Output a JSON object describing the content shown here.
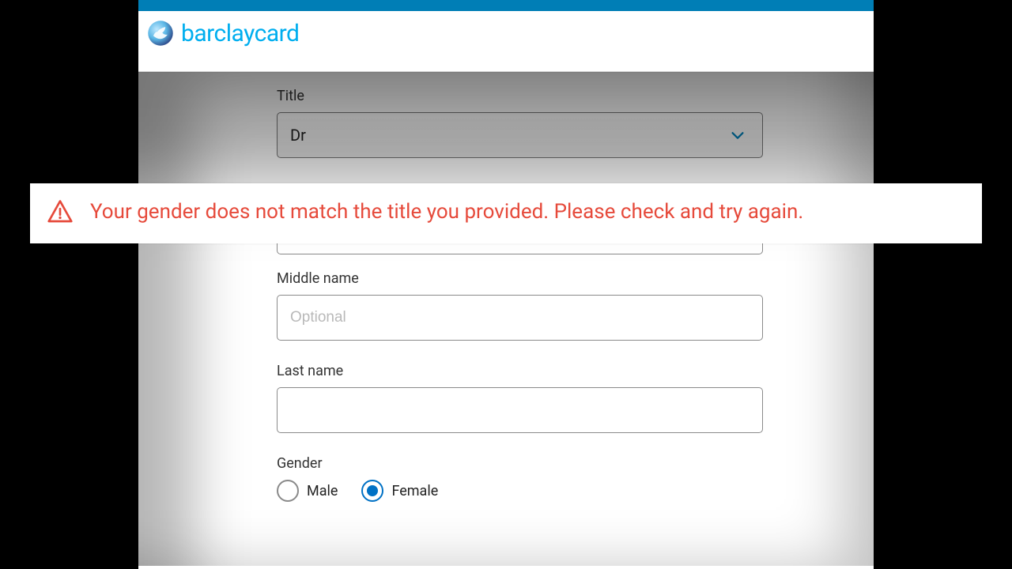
{
  "brand": {
    "name": "barclaycard"
  },
  "colors": {
    "blue_bar": "#007eb6",
    "brand_text": "#00aeef",
    "accent": "#0071c5",
    "error": "#e64a3b"
  },
  "form": {
    "title": {
      "label": "Title",
      "value": "Dr"
    },
    "middle_name": {
      "label": "Middle name",
      "placeholder": "Optional",
      "value": ""
    },
    "last_name": {
      "label": "Last name",
      "value": ""
    },
    "gender": {
      "label": "Gender",
      "options": [
        {
          "label": "Male",
          "value": "male",
          "checked": false
        },
        {
          "label": "Female",
          "value": "female",
          "checked": true
        }
      ]
    }
  },
  "alert": {
    "message": "Your gender does not match the title you provided. Please check and try again."
  }
}
